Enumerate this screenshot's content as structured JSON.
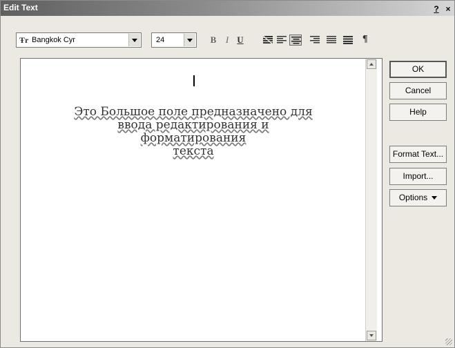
{
  "window": {
    "title": "Edit Text",
    "help_label": "?",
    "close_label": "×"
  },
  "toolbar": {
    "font_name": "Bangkok Cyr",
    "font_icon": "Ŧr",
    "font_size": "24",
    "bold_label": "B",
    "italic_label": "I",
    "underline_label": "U",
    "paragraph_label": "¶",
    "alignment_active": "center"
  },
  "editor": {
    "lines": [
      "Это Большое поле предназначено для",
      "ввода редактирования и",
      "форматирования",
      "текста"
    ]
  },
  "buttons": {
    "ok": "OK",
    "cancel": "Cancel",
    "help": "Help",
    "format_text": "Format Text...",
    "import": "Import...",
    "options": "Options"
  },
  "colors": {
    "dialog_bg": "#ece9e2",
    "titlebar_start": "#5f5f5f",
    "titlebar_end": "#d6d6d6"
  },
  "icons": [
    "font-type-icon",
    "dropdown-arrow-icon",
    "align-none-icon",
    "align-left-icon",
    "align-center-icon",
    "align-right-icon",
    "align-justify-icon",
    "paragraph-icon"
  ]
}
